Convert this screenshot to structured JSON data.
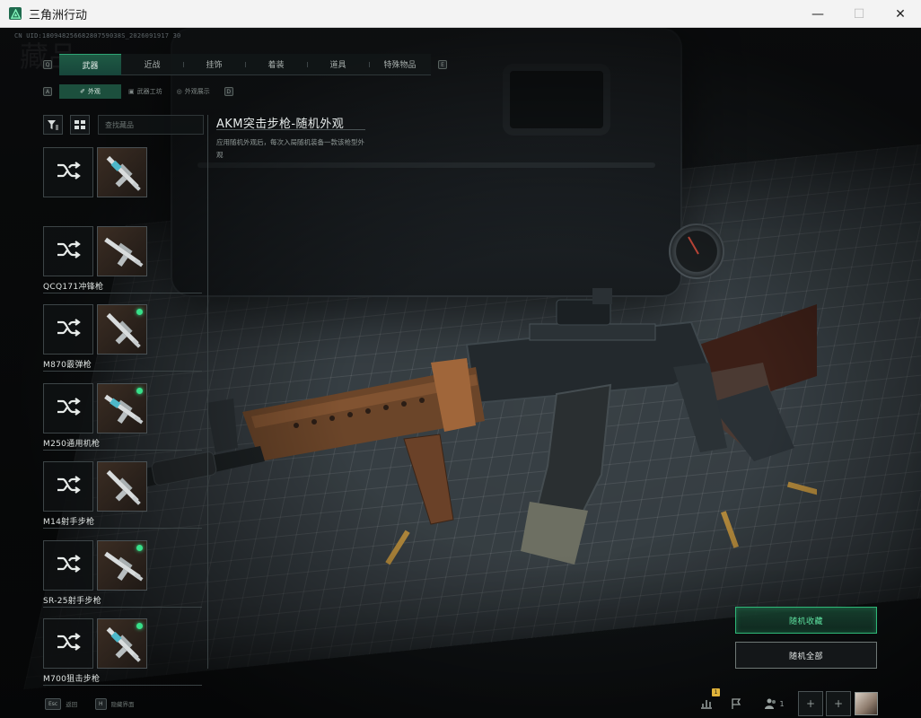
{
  "window": {
    "title": "三角洲行动",
    "minimize": "—",
    "maximize": "☐",
    "close": "✕"
  },
  "uid_text": "CN UID:18094825668280759038S_2026091917 30",
  "main_tabs": {
    "prev_key": "Q",
    "next_key": "E",
    "items": [
      {
        "label": "武器",
        "active": true
      },
      {
        "label": "近战",
        "active": false
      },
      {
        "label": "挂饰",
        "active": false
      },
      {
        "label": "着装",
        "active": false
      },
      {
        "label": "道具",
        "active": false
      },
      {
        "label": "特殊物品",
        "active": false
      }
    ]
  },
  "sub_tabs": {
    "prev_key": "A",
    "next_key": "D",
    "items": [
      {
        "icon": "✐",
        "label": "外观",
        "active": true
      },
      {
        "icon": "▣",
        "label": "武器工坊",
        "active": false
      },
      {
        "icon": "◎",
        "label": "外观展示",
        "active": false
      }
    ]
  },
  "search": {
    "placeholder": "查找藏品"
  },
  "weapons": [
    {
      "name": "",
      "has_new": false
    },
    {
      "name": "QCQ171冲锋枪",
      "has_new": false
    },
    {
      "name": "M870霰弹枪",
      "has_new": true
    },
    {
      "name": "M250通用机枪",
      "has_new": true
    },
    {
      "name": "M14射手步枪",
      "has_new": false
    },
    {
      "name": "SR-25射手步枪",
      "has_new": true
    },
    {
      "name": "M700狙击步枪",
      "has_new": true
    }
  ],
  "selected": {
    "title": "AKM突击步枪-随机外观",
    "description": "应用随机外观后，每次入局随机装备一款该枪型外观"
  },
  "actions": {
    "random_favorite": "随机收藏",
    "random_all": "随机全部"
  },
  "bottom_hints": [
    {
      "key": "Esc",
      "label": "返回"
    },
    {
      "key": "H",
      "label": "隐藏界面"
    }
  ],
  "bottom_bar": {
    "notification_badge": "1",
    "player_count": "1"
  },
  "colors": {
    "accent_green": "#2eb777",
    "new_dot": "#38e08a",
    "tab_active": "#1e5a44"
  }
}
